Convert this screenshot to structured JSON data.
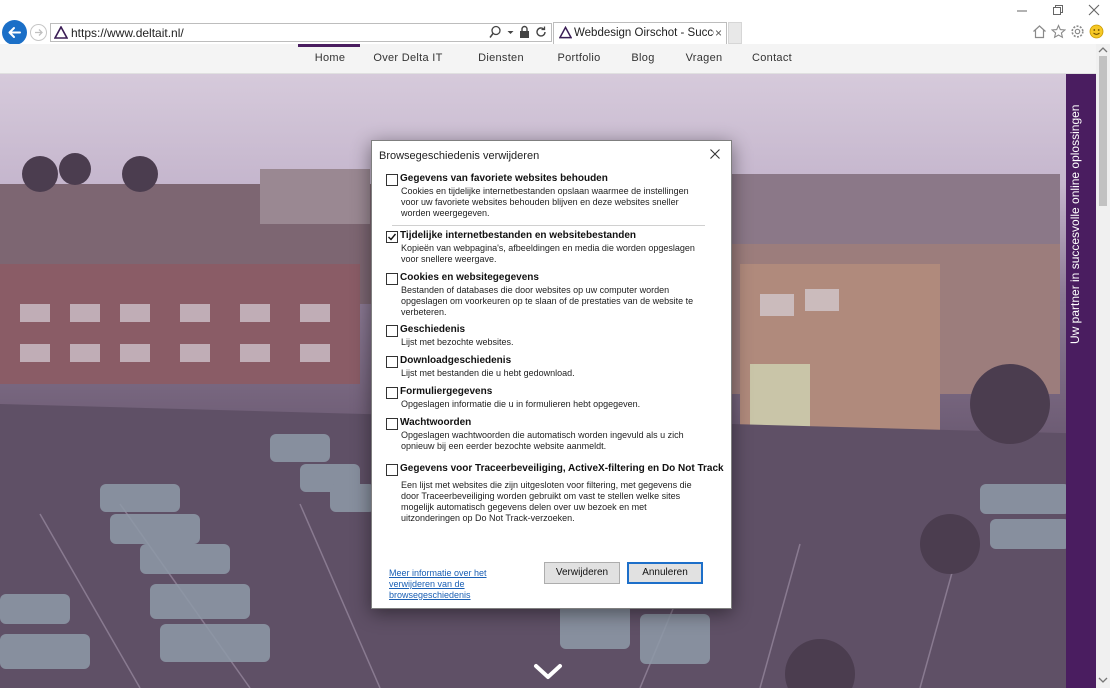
{
  "browser": {
    "url": "https://www.deltait.nl/",
    "tab_title": "Webdesign Oirschot - Succes...",
    "tab_close": "×"
  },
  "site_nav": {
    "items": [
      "Home",
      "Over Delta IT",
      "Diensten",
      "Portfolio",
      "Blog",
      "Vragen",
      "Contact"
    ],
    "active": "Home"
  },
  "hero": {
    "side_banner": "Uw partner in succesvolle online oplossingen"
  },
  "dialog": {
    "title": "Browsegeschiedenis verwijderen",
    "options": [
      {
        "title": "Gegevens van favoriete websites behouden",
        "desc": "Cookies en tijdelijke internetbestanden opslaan waarmee de instellingen voor uw favoriete websites behouden blijven en deze websites sneller worden weergegeven.",
        "checked": false
      },
      {
        "title": "Tijdelijke internetbestanden en websitebestanden",
        "desc": "Kopieën van webpagina's, afbeeldingen en media die worden opgeslagen voor snellere weergave.",
        "checked": true
      },
      {
        "title": "Cookies en websitegegevens",
        "desc": "Bestanden of databases die door websites op uw computer worden opgeslagen om voorkeuren op te slaan of de prestaties van de website te verbeteren.",
        "checked": false
      },
      {
        "title": "Geschiedenis",
        "desc": "Lijst met bezochte websites.",
        "checked": false
      },
      {
        "title": "Downloadgeschiedenis",
        "desc": "Lijst met bestanden die u hebt gedownload.",
        "checked": false
      },
      {
        "title": "Formuliergegevens",
        "desc": "Opgeslagen informatie die u in formulieren hebt opgegeven.",
        "checked": false
      },
      {
        "title": "Wachtwoorden",
        "desc": "Opgeslagen wachtwoorden die automatisch worden ingevuld als u zich opnieuw bij een eerder bezochte website aanmeldt.",
        "checked": false
      },
      {
        "title": "Gegevens voor Traceerbeveiliging, ActiveX-filtering en Do Not Track",
        "desc": "Een lijst met websites die zijn uitgesloten voor filtering, met gegevens die door Traceerbeveiliging worden gebruikt om vast te stellen welke sites mogelijk automatisch gegevens delen over uw bezoek en met uitzonderingen op Do Not Track-verzoeken.",
        "checked": false
      }
    ],
    "more_info_link": "Meer informatie over het verwijderen van de browsegeschiedenis",
    "delete_button": "Verwijderen",
    "cancel_button": "Annuleren"
  },
  "colors": {
    "brand_purple": "#4a1d60",
    "back_button_blue": "#1b6fc7",
    "link_blue": "#1a5fb4"
  }
}
